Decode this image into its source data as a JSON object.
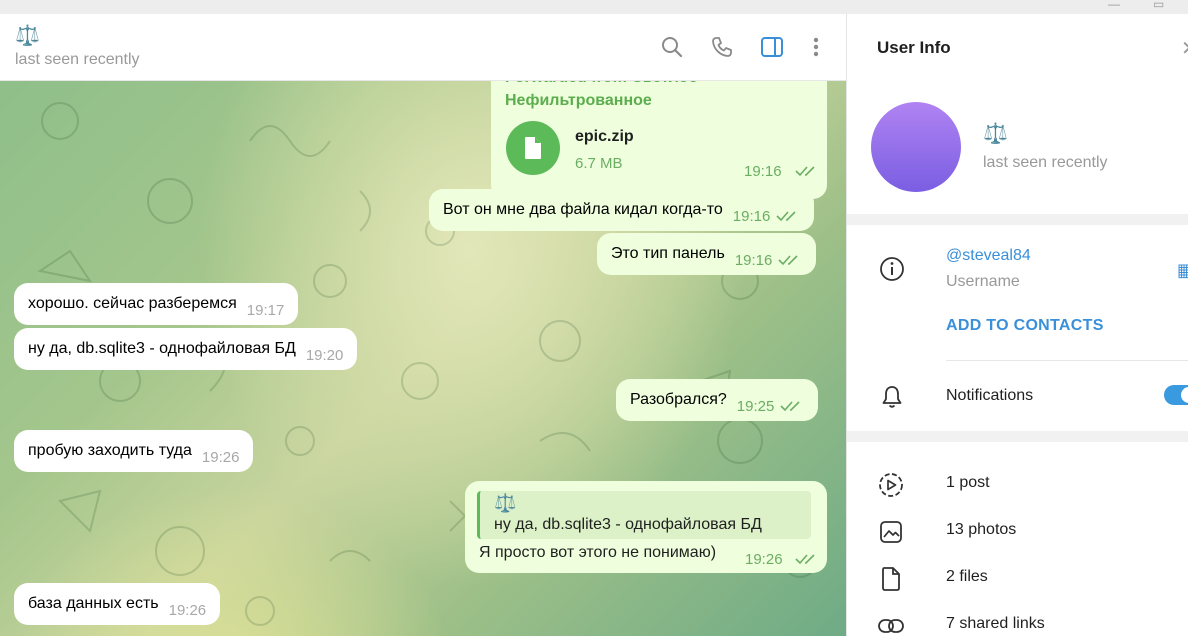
{
  "chat": {
    "peer_emoji": "⚖️",
    "peer_status": "last seen recently",
    "header_icons": [
      "search-icon",
      "phone-icon",
      "sidebar-toggle-icon",
      "more-vertical-icon"
    ],
    "forwarded": {
      "from_line1": "Forwarded from Светлое",
      "from_line2": "Нефильтрованное",
      "file_name": "epic.zip",
      "file_size": "6.7 MB",
      "time": "19:16"
    },
    "messages": [
      {
        "dir": "out",
        "text": "Вот он мне два файла кидал когда-то",
        "time": "19:16"
      },
      {
        "dir": "out",
        "text": "Это тип панель",
        "time": "19:16"
      },
      {
        "dir": "in",
        "text": "хорошо. сейчас разберемся",
        "time": "19:17"
      },
      {
        "dir": "in",
        "text": "ну да, db.sqlite3 - однофайловая БД",
        "time": "19:20"
      },
      {
        "dir": "out",
        "text": "Разобрался?",
        "time": "19:25"
      },
      {
        "dir": "in",
        "text": "пробую заходить туда",
        "time": "19:26"
      },
      {
        "dir": "in",
        "text": "база данных есть",
        "time": "19:26"
      }
    ],
    "reply": {
      "quote_emoji": "⚖️",
      "quote_text": "ну да, db.sqlite3 - однофайловая БД",
      "text": "Я просто вот этого не понимаю)",
      "time": "19:26"
    },
    "colors": {
      "incoming": "#ffffff",
      "outgoing": "#effedd",
      "accent_green": "#5dba58"
    }
  },
  "panel": {
    "title": "User Info",
    "peer_emoji": "⚖️",
    "status": "last seen recently",
    "username": "@steveal84",
    "username_label": "Username",
    "add_contact": "ADD TO CONTACTS",
    "notifications": "Notifications",
    "notifications_on": true,
    "media": [
      {
        "icon": "stories-icon",
        "label": "1 post"
      },
      {
        "icon": "photo-icon",
        "label": "13 photos"
      },
      {
        "icon": "file-icon",
        "label": "2 files"
      },
      {
        "icon": "link-icon",
        "label": "7 shared links"
      }
    ],
    "colors": {
      "link": "#3a8fd9",
      "avatar_top": "#b083f2",
      "avatar_bottom": "#7a5ee2"
    }
  }
}
